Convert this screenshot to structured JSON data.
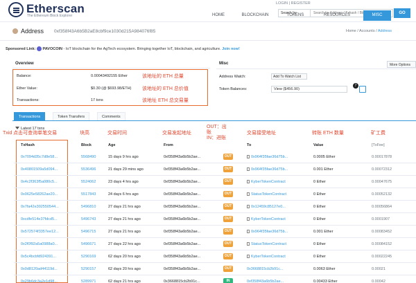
{
  "header": {
    "logo_title": "Etherscan",
    "logo_subtitle": "The Ethereum Block Explorer",
    "toplinks": "LOGIN | REGISTER",
    "search_filter": "Search by",
    "search_placeholder": "Search by Address / Txhash / Block / Token / Ens",
    "go_label": "GO",
    "nav": [
      "HOME",
      "BLOCKCHAIN",
      "TOKENS",
      "RESOURCES",
      "MISC"
    ],
    "active_nav": "MISC"
  },
  "address": {
    "label": "Address",
    "value": "0xf358f43A6b5B2aE8cbf9ce1030d215A984076f85"
  },
  "breadcrumb": {
    "home": "Home",
    "accounts": "Accounts",
    "current": "Address"
  },
  "sponsor": {
    "prefix": "Sponsored Link:",
    "brand": "PAVOCOIN",
    "text": "- IoT blockchain for the AgTech ecosystem. Bringing together IoT, blockchain, and agriculture.",
    "cta": "Join now!"
  },
  "overview": {
    "title": "Overview",
    "rows": [
      {
        "label": "Balance:",
        "value": "0.00043492155 Ether",
        "note": "该地址的 ETH 总量"
      },
      {
        "label": "Ether Value:",
        "value": "$0.30 (@ $693.98/ETH)",
        "note": "该地址的 ETH 总价值"
      },
      {
        "label": "Transactions:",
        "value": "17 txns",
        "note": "该地址 ETH 总交易量"
      }
    ]
  },
  "misc": {
    "title": "Misc",
    "more_options": "More Options",
    "address_watch_label": "Address Watch:",
    "watch_button": "Add To Watch List",
    "token_balances_label": "Token Balances:",
    "token_balances_value": "View ($456.90)",
    "token_count": "7"
  },
  "tabs": [
    "Transactions",
    "Token Transfers",
    "Comments"
  ],
  "latest_label": "Latest 17 txns",
  "latest_sub": "Txid 点击可查询单笔交易",
  "annotations": {
    "block": "块高",
    "age": "交易时间",
    "from": "交易发起地址",
    "outin": "OUT：出账\nIN：进账",
    "to": "交易接受地址",
    "value": "转账 ETH 数量",
    "fee": "矿工费"
  },
  "table": {
    "headers": [
      "TxHash",
      "Block",
      "Age",
      "From",
      "",
      "To",
      "Value",
      "[TxFee]"
    ],
    "rows": [
      {
        "hash": "0x7094d35c7d8e58...",
        "block": "5568490",
        "age": "15 days 9 hrs ago",
        "from": "0xf358f43a6b5b2ae...",
        "dir": "OUT",
        "to": "0x964f35fae36d75b...",
        "to_contract": true,
        "value": "0.0005 Ether",
        "fee": "0.00017878"
      },
      {
        "hash": "0x40801509a5d094...",
        "block": "5536496",
        "age": "21 days 29 mins ago",
        "from": "0xf358f43a6b5b2ae...",
        "dir": "OUT",
        "to": "0x964f35fae36d75b...",
        "to_contract": true,
        "value": "0.001 Ether",
        "fee": "0.00072312"
      },
      {
        "hash": "0x4c2f363f5a080c5...",
        "block": "5524062",
        "age": "23 days 4 hrs ago",
        "from": "0xf358f43a6b5b2ae...",
        "dir": "OUT",
        "to": "KyberTokenContract",
        "to_contract": true,
        "value": "0 Ether",
        "fee": "0.00047675"
      },
      {
        "hash": "0x0625e58262ae20...",
        "block": "5517843",
        "age": "24 days 6 hrs ago",
        "from": "0xf358f43a6b5b2ae...",
        "dir": "OUT",
        "to": "StatusTokenContract",
        "to_contract": true,
        "value": "0 Ether",
        "fee": "0.00052132"
      },
      {
        "hash": "0x7fa42e302550544...",
        "block": "5496810",
        "age": "27 days 21 hrs ago",
        "from": "0xf358f43a6b5b2ae...",
        "dir": "OUT",
        "to": "0x12459c85127e0...",
        "to_contract": true,
        "value": "0 Ether",
        "fee": "0.00056864"
      },
      {
        "hash": "0xcdfe514e37fdcd5...",
        "block": "5496743",
        "age": "27 days 21 hrs ago",
        "from": "0xf358f43a6b5b2ae...",
        "dir": "OUT",
        "to": "KyberTokenContract",
        "to_contract": true,
        "value": "0 Ether",
        "fee": "0.0001907"
      },
      {
        "hash": "0x572574f3357ee12...",
        "block": "5496715",
        "age": "27 days 21 hrs ago",
        "from": "0xf358f43a6b5b2ae...",
        "dir": "OUT",
        "to": "0x964f35fae36d75b...",
        "to_contract": true,
        "value": "0.001 Ether",
        "fee": "0.00083452"
      },
      {
        "hash": "0x2f0f92a5a0988a0...",
        "block": "5496671",
        "age": "27 days 22 hrs ago",
        "from": "0xf358f43a6b5b2ae...",
        "dir": "OUT",
        "to": "StatusTokenContract",
        "to_contract": true,
        "value": "0 Ether",
        "fee": "0.00084152"
      },
      {
        "hash": "0x5c4bcbfd924391...",
        "block": "5290169",
        "age": "62 days 20 hrs ago",
        "from": "0xf358f43a6b5b2ae...",
        "dir": "OUT",
        "to": "KyberTokenContract",
        "to_contract": true,
        "value": "0 Ether",
        "fee": "0.00022245"
      },
      {
        "hash": "0x0d8120ad44119d...",
        "block": "5290157",
        "age": "62 days 20 hrs ago",
        "from": "0xf358f43a6b5b2ae...",
        "dir": "OUT",
        "to": "0x3668815cb2b91c...",
        "to_contract": false,
        "value": "0.0063 Ether",
        "fee": "0.00021"
      },
      {
        "hash": "0x29b6dc3a2e1d98...",
        "block": "5289971",
        "age": "62 days 21 hrs ago",
        "from": "0x3668815cb2b91c...",
        "dir": "IN",
        "to": "0xf358f43a6b5b2ae...",
        "to_contract": false,
        "value": "0.00433 Ether",
        "fee": "0.00042"
      }
    ]
  },
  "colors": {
    "brand": "#21325b",
    "accent": "#3498db",
    "annotation": "#e0452c",
    "out_badge": "#f0a23a",
    "in_badge": "#2eb87e"
  }
}
